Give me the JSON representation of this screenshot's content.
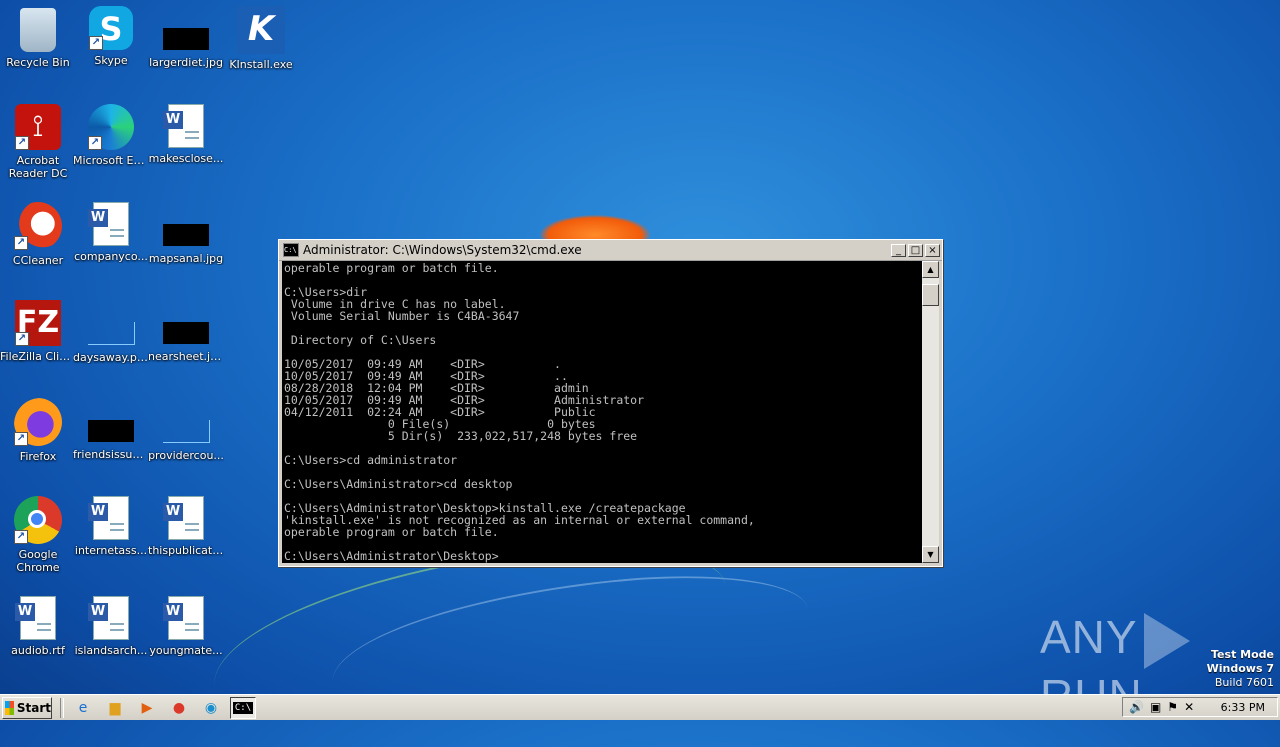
{
  "desktop": {
    "icons": [
      {
        "label": "Recycle Bin",
        "icon": "recycle-bin-icon"
      },
      {
        "label": "Skype",
        "icon": "skype-icon"
      },
      {
        "label": "largerdiet.jpg",
        "icon": "image-file-icon"
      },
      {
        "label": "KInstall.exe",
        "icon": "kinstall-icon"
      },
      {
        "label": "Acrobat Reader DC",
        "icon": "acrobat-icon"
      },
      {
        "label": "Microsoft Edge",
        "icon": "edge-icon"
      },
      {
        "label": "makesclose...",
        "icon": "word-doc-icon"
      },
      {
        "label": "CCleaner",
        "icon": "ccleaner-icon"
      },
      {
        "label": "companyco...",
        "icon": "word-doc-icon"
      },
      {
        "label": "mapsanal.jpg",
        "icon": "image-file-icon"
      },
      {
        "label": "FileZilla Client",
        "icon": "filezilla-icon"
      },
      {
        "label": "daysaway.png",
        "icon": "image-file-icon"
      },
      {
        "label": "nearsheet.jpg",
        "icon": "image-file-icon"
      },
      {
        "label": "Firefox",
        "icon": "firefox-icon"
      },
      {
        "label": "friendsissue...",
        "icon": "image-file-icon"
      },
      {
        "label": "providercou...",
        "icon": "image-file-icon"
      },
      {
        "label": "Google Chrome",
        "icon": "chrome-icon"
      },
      {
        "label": "internetass...",
        "icon": "word-doc-icon"
      },
      {
        "label": "thispublicati...",
        "icon": "word-doc-icon"
      },
      {
        "label": "audiob.rtf",
        "icon": "word-doc-icon"
      },
      {
        "label": "islandsarch...",
        "icon": "word-doc-icon"
      },
      {
        "label": "youngmate...",
        "icon": "word-doc-icon"
      }
    ]
  },
  "cmd": {
    "title": "Administrator: C:\\Windows\\System32\\cmd.exe",
    "icon_text": "C:\\",
    "minimize": "_",
    "maximize": "□",
    "close": "×",
    "output": "operable program or batch file.\n\nC:\\Users>dir\n Volume in drive C has no label.\n Volume Serial Number is C4BA-3647\n\n Directory of C:\\Users\n\n10/05/2017  09:49 AM    <DIR>          .\n10/05/2017  09:49 AM    <DIR>          ..\n08/28/2018  12:04 PM    <DIR>          admin\n10/05/2017  09:49 AM    <DIR>          Administrator\n04/12/2011  02:24 AM    <DIR>          Public\n               0 File(s)              0 bytes\n               5 Dir(s)  233,022,517,248 bytes free\n\nC:\\Users>cd administrator\n\nC:\\Users\\Administrator>cd desktop\n\nC:\\Users\\Administrator\\Desktop>kinstall.exe /createpackage\n'kinstall.exe' is not recognized as an internal or external command,\noperable program or batch file.\n\nC:\\Users\\Administrator\\Desktop>"
  },
  "watermark": {
    "left": "ANY",
    "right": "RUN",
    "line1": "Test Mode",
    "line2": "Windows 7",
    "line3": "Build 7601"
  },
  "taskbar": {
    "start_label": "Start",
    "clock": "6:33 PM"
  }
}
